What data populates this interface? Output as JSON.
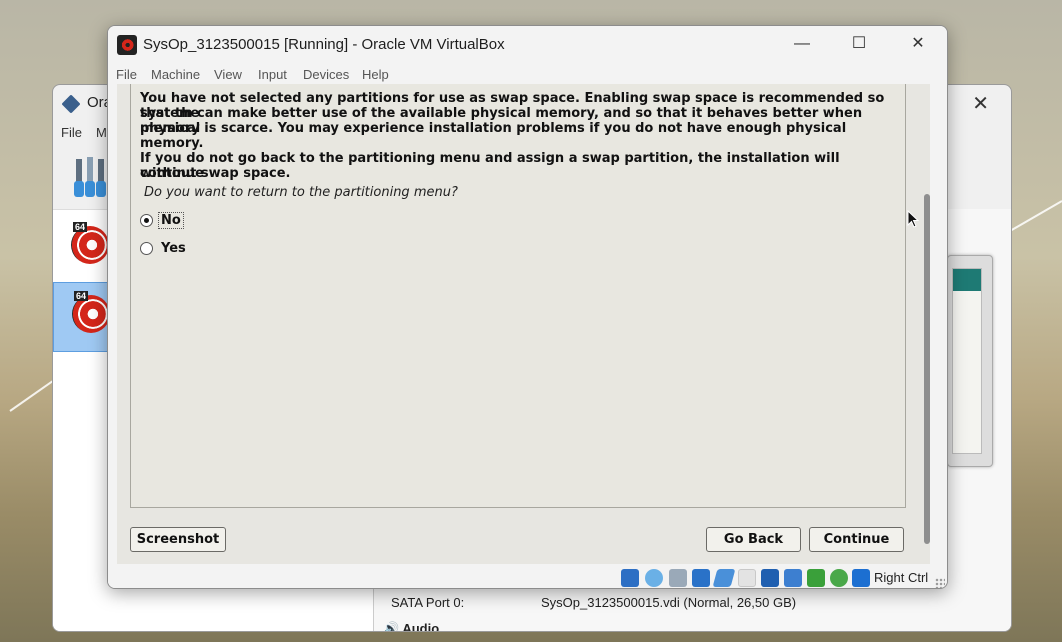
{
  "manager": {
    "title": "Ora",
    "menu": [
      "File",
      "M"
    ],
    "vms": [
      {
        "badge": "64"
      },
      {
        "badge": "64"
      }
    ],
    "storage_label": "SATA Port 0:",
    "storage_value": "SysOp_3123500015.vdi (Normal, 26,50 GB)",
    "audio_label": "Audio"
  },
  "vm_window": {
    "title": "SysOp_3123500015 [Running] - Oracle VM VirtualBox",
    "menu": [
      "File",
      "Machine",
      "View",
      "Input",
      "Devices",
      "Help"
    ],
    "controls": {
      "minimize": "—",
      "maximize": "☐",
      "close": "✕"
    }
  },
  "installer": {
    "message_lines": [
      "You have not selected any partitions for use as swap space. Enabling swap space is recommended so that the",
      "system can make better use of the available physical memory, and so that it behaves better when physical",
      "memory is scarce. You may experience installation problems if you do not have enough physical memory."
    ],
    "message2_lines": [
      "If you do not go back to the partitioning menu and assign a swap partition, the installation will continue",
      "without swap space."
    ],
    "question": "Do you want to return to the partitioning menu?",
    "options": [
      {
        "label": "No",
        "selected": true
      },
      {
        "label": "Yes",
        "selected": false
      }
    ],
    "buttons": {
      "screenshot": "Screenshot",
      "go_back": "Go Back",
      "continue": "Continue"
    }
  },
  "statusbar": {
    "icons": [
      "hard-disk-icon",
      "optical-drive-icon",
      "audio-icon",
      "network-icon",
      "usb-icon",
      "shared-folders-icon",
      "display-icon",
      "video-capture-icon",
      "cpu-icon",
      "mouse-integration-icon",
      "keyboard-icon"
    ],
    "host_key": "Right Ctrl"
  },
  "colors": {
    "guest_bg": "#e8e7e0",
    "vm_selected": "#9fc9f3"
  }
}
